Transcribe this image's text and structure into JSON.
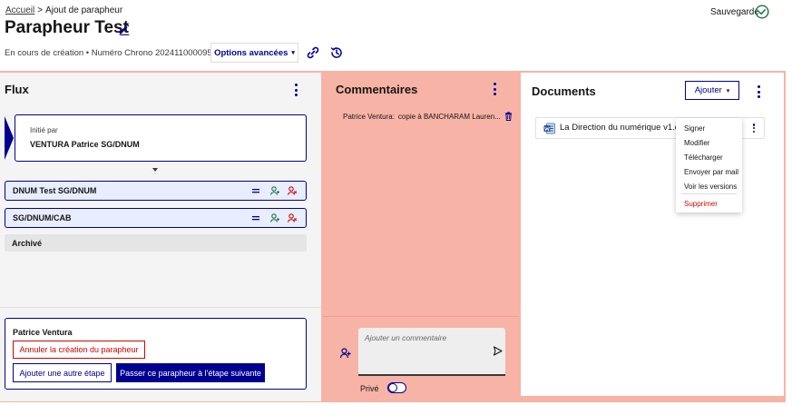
{
  "header": {
    "breadcrumb": {
      "home": "Accueil",
      "separator": ">",
      "current": "Ajout de parapheur"
    },
    "title": "Parapheur Test",
    "subtitle": "En cours de création • Numéro Chrono 2024110000951",
    "options_label": "Options avancées",
    "saved_label": "Sauvegardé"
  },
  "flux": {
    "title": "Flux",
    "initiated": {
      "label": "Initié par",
      "name": "VENTURA Patrice SG/DNUM"
    },
    "steps": [
      {
        "label": "DNUM Test SG/DNUM"
      },
      {
        "label": "SG/DNUM/CAB"
      }
    ],
    "archive_label": "Archivé",
    "actor": {
      "name": "Patrice Ventura",
      "cancel_label": "Annuler la création du parapheur",
      "add_step_label": "Ajouter une autre étape",
      "next_step_label": "Passer ce parapheur à l'étape suivante"
    }
  },
  "comments": {
    "title": "Commentaires",
    "items": [
      {
        "author": "Patrice Ventura:",
        "text": "copie à BANCHARAM Lauren..."
      }
    ],
    "input_placeholder": "Ajouter un commentaire",
    "private_label": "Privé"
  },
  "documents": {
    "title": "Documents",
    "add_label": "Ajouter",
    "items": [
      {
        "name": "La Direction du numérique v1.docx",
        "icon": "word-icon"
      }
    ],
    "menu": [
      "Signer",
      "Modifier",
      "Télécharger",
      "Envoyer par mail",
      "Voir les versions"
    ],
    "menu_danger": "Supprimer"
  },
  "colors": {
    "primary": "#000091",
    "danger": "#ce0500",
    "success": "#18753c",
    "highlight": "#f7b3a5"
  }
}
